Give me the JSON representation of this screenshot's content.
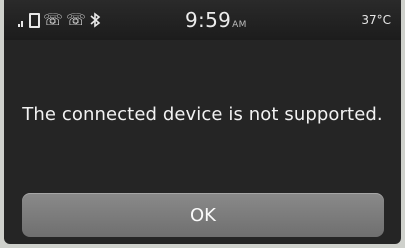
{
  "status_bar": {
    "time": "9:59",
    "ampm": "AM",
    "temperature": "37°C",
    "icons": [
      "signal-strength-icon",
      "sd-card-icon",
      "handset-1-icon",
      "handset-2-icon",
      "bluetooth-icon"
    ]
  },
  "dialog": {
    "message": "The connected device is not supported.",
    "ok_label": "OK"
  },
  "colors": {
    "screen_bg": "#252525",
    "button_bg": "#7d7d7d",
    "text": "#f2f2f2"
  }
}
